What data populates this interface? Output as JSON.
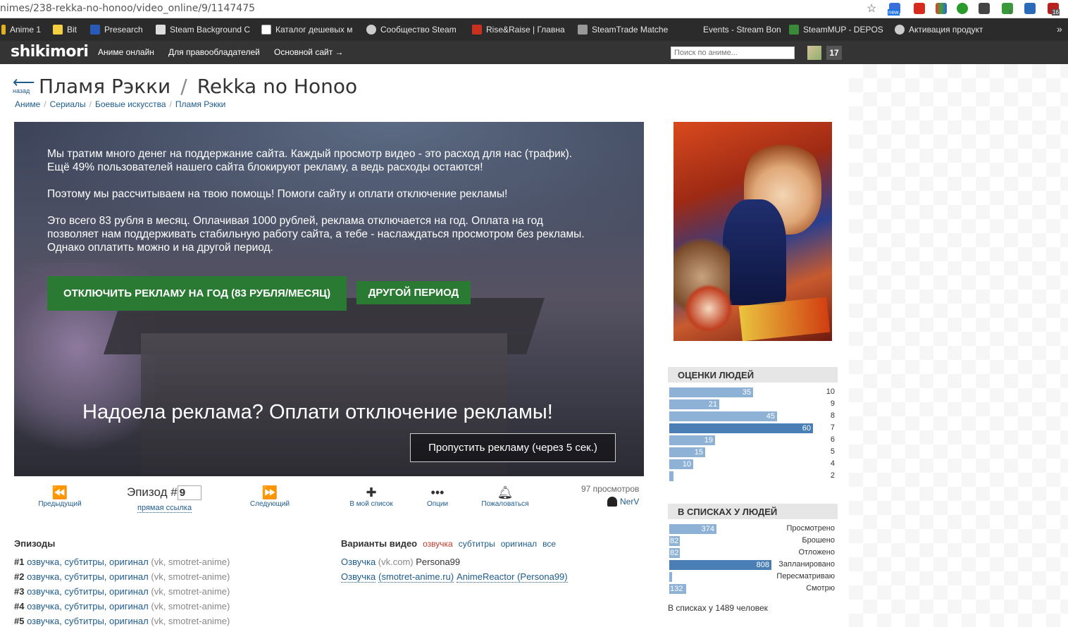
{
  "browser": {
    "url": "nimes/238-rekka-no-honoo/video_online/9/1147475",
    "ext_badges": {
      "new": "new",
      "nine": "9",
      "sixteen": "16"
    },
    "bookmarks": [
      "Anime 1",
      "Bit",
      "Presearch",
      "Steam Background C",
      "Каталог дешевых м",
      "Сообщество Steam",
      "Rise&Raise | Главна",
      "SteamTrade Matche",
      "Events - Stream Bon",
      "SteamMUP - DEPOS",
      "Активация продукт"
    ]
  },
  "site": {
    "logo": "shikimori",
    "nav": [
      "Аниме онлайн",
      "Для правообладателей",
      "Основной сайт →"
    ],
    "search_placeholder": "Поиск по аниме...",
    "notif_count": "17"
  },
  "page": {
    "back_label": "назад",
    "back_arrow": "⟵",
    "title_ru": "Пламя Рэкки",
    "title_sep": "/",
    "title_romaji": "Rekka no Honoo",
    "breadcrumbs": [
      "Аниме",
      "Сериалы",
      "Боевые искусства",
      "Пламя Рэкки"
    ]
  },
  "ad": {
    "para1_line1": "Мы тратим много денег на поддержание сайта. Каждый просмотр видео - это расход для нас (трафик).",
    "para1_line2": "Ещё 49% пользователей нашего сайта блокируют рекламу, а ведь расходы остаются!",
    "para2": "Поэтому мы рассчитываем на твою помощь! Помоги сайту и оплати отключение рекламы!",
    "para3_line1": "Это всего 83 рубля в месяц. Оплачивая 1000 рублей, реклама отключается на год. Оплата на год",
    "para3_line2": "позволяет нам поддерживать стабильную работу сайта, а тебе - наслаждаться просмотром без рекламы.",
    "para3_line3": "Однако оплатить можно и на другой период.",
    "btn_year": "ОТКЛЮЧИТЬ РЕКЛАМУ НА ГОД (83 РУБЛЯ/МЕСЯЦ)",
    "btn_other": "ДРУГОЙ ПЕРИОД",
    "headline": "Надоела реклама? Оплати отключение рекламы!",
    "skip": "Пропустить рекламу (через 5 сек.)"
  },
  "controls": {
    "prev": "Предыдущий",
    "episode_label": "Эпизод #",
    "episode_value": "9",
    "direct_link": "прямая ссылка",
    "next": "Следующий",
    "add_list": "В мой список",
    "options": "Опции",
    "report": "Пожаловаться",
    "views": "97 просмотров",
    "uploader": "NerV"
  },
  "episodes": {
    "heading": "Эпизоды",
    "rows": [
      {
        "num": "#1",
        "links": "озвучка, субтитры, оригинал",
        "src": "(vk, smotret-anime)"
      },
      {
        "num": "#2",
        "links": "озвучка, субтитры, оригинал",
        "src": "(vk, smotret-anime)"
      },
      {
        "num": "#3",
        "links": "озвучка, субтитры, оригинал",
        "src": "(vk, smotret-anime)"
      },
      {
        "num": "#4",
        "links": "озвучка, субтитры, оригинал",
        "src": "(vk, smotret-anime)"
      },
      {
        "num": "#5",
        "links": "озвучка, субтитры, оригинал",
        "src": "(vk, smotret-anime)"
      }
    ]
  },
  "variants": {
    "heading": "Варианты видео",
    "filters": [
      "озвучка",
      "субтитры",
      "оригинал",
      "все"
    ],
    "active_color": "#c0392b",
    "items": [
      {
        "kind": "Озвучка",
        "host": "(vk.com)",
        "author": "Persona99"
      },
      {
        "kind": "Озвучка",
        "host": "(smotret-anime.ru)",
        "author": "AnimeReactor (Persona99)"
      }
    ]
  },
  "ratings": {
    "heading": "ОЦЕНКИ ЛЮДЕЙ",
    "bars": [
      {
        "score": "10",
        "count": 35
      },
      {
        "score": "9",
        "count": 21
      },
      {
        "score": "8",
        "count": 45
      },
      {
        "score": "7",
        "count": 60
      },
      {
        "score": "6",
        "count": 19
      },
      {
        "score": "5",
        "count": 15
      },
      {
        "score": "4",
        "count": 10
      },
      {
        "score": "2",
        "count": 1
      }
    ],
    "color_light": "#8db2d6",
    "color_dark": "#4a7fb5"
  },
  "lists": {
    "heading": "В СПИСКАХ У ЛЮДЕЙ",
    "bars": [
      {
        "label": "Просмотрено",
        "count": 374
      },
      {
        "label": "Брошено",
        "count": 82
      },
      {
        "label": "Отложено",
        "count": 82
      },
      {
        "label": "Запланировано",
        "count": 808
      },
      {
        "label": "Пересматриваю",
        "count": 1
      },
      {
        "label": "Смотрю",
        "count": 132
      }
    ],
    "total": "В списках у 1489 человек"
  }
}
